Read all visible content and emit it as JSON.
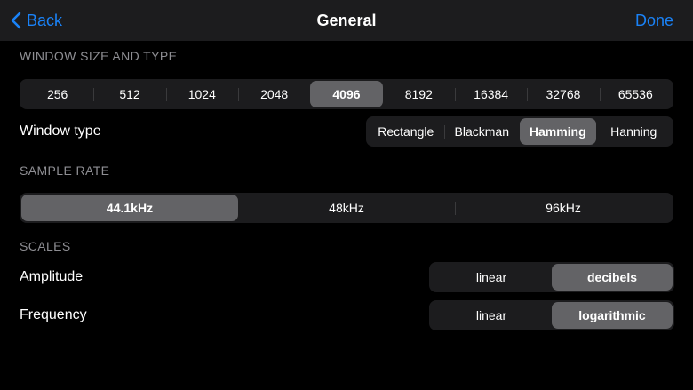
{
  "nav": {
    "back_label": "Back",
    "title": "General",
    "done_label": "Done",
    "accent": "#1a82f7"
  },
  "window_section": {
    "header": "WINDOW SIZE AND TYPE",
    "sizes": [
      "256",
      "512",
      "1024",
      "2048",
      "4096",
      "8192",
      "16384",
      "32768",
      "65536"
    ],
    "selected_size": "4096",
    "type_label": "Window type",
    "types": [
      "Rectangle",
      "Blackman",
      "Hamming",
      "Hanning"
    ],
    "selected_type": "Hamming"
  },
  "sample_rate_section": {
    "header": "SAMPLE RATE",
    "rates": [
      "44.1kHz",
      "48kHz",
      "96kHz"
    ],
    "selected_rate": "44.1kHz"
  },
  "scales_section": {
    "header": "SCALES",
    "amplitude_label": "Amplitude",
    "amplitude_options": [
      "linear",
      "decibels"
    ],
    "amplitude_selected": "decibels",
    "frequency_label": "Frequency",
    "frequency_options": [
      "linear",
      "logarithmic"
    ],
    "frequency_selected": "logarithmic"
  }
}
